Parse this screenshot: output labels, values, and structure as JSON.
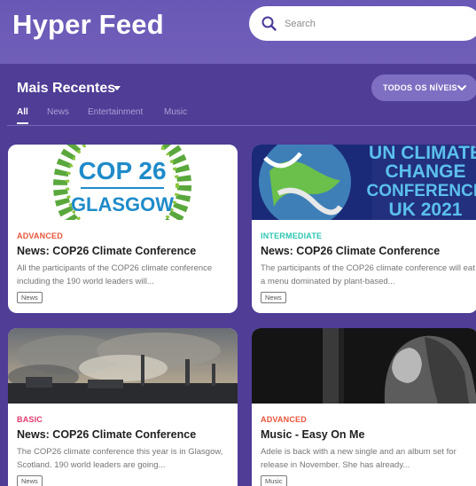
{
  "header": {
    "app_title": "Hyper Feed",
    "search_placeholder": "Search"
  },
  "filters": {
    "section_title": "Mais Recentes",
    "level_button": "TODOS OS NÍVEIS",
    "tabs": [
      {
        "label": "All",
        "active": true
      },
      {
        "label": "News",
        "active": false
      },
      {
        "label": "Entertainment",
        "active": false
      },
      {
        "label": "Music",
        "active": false
      }
    ]
  },
  "thumbnails": {
    "cop26_line1": "COP 26",
    "cop26_line2": "GLASGOW",
    "unclimate_lines": [
      "UN CLIMATE",
      "CHANGE",
      "CONFERENCE",
      "UK 2021"
    ]
  },
  "cards": [
    {
      "level": "ADVANCED",
      "level_color": "#e9553a",
      "title": "News: COP26 Climate Conference",
      "description": "All the participants of the COP26 climate conference including the 190 world leaders will...",
      "tag": "News"
    },
    {
      "level": "INTERMEDIATE",
      "level_color": "#2cc6b2",
      "title": "News: COP26 Climate Conference",
      "description": "The participants of the COP26 climate conference will eat a menu dominated by plant-based...",
      "tag": "News"
    },
    {
      "level": "BASIC",
      "level_color": "#e6396f",
      "title": "News: COP26 Climate Conference",
      "description": "The COP26 climate conference this year is in Glasgow, Scotland. 190 world leaders are going...",
      "tag": "News"
    },
    {
      "level": "ADVANCED",
      "level_color": "#e9553a",
      "title": "Music - Easy On Me",
      "description": "Adele is back with a new single and an album set for release in November. She has already...",
      "tag": "Music"
    }
  ],
  "colors": {
    "header_bg": "#705fb9",
    "page_bg": "#4f3d96",
    "accent_button": "#7f6fc2"
  }
}
